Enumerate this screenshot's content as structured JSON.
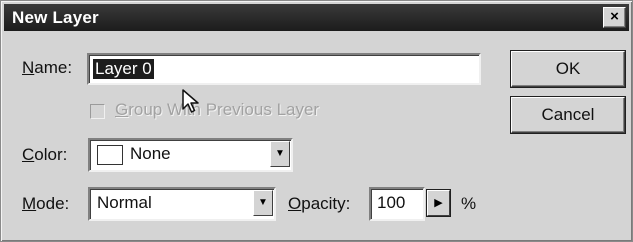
{
  "dialog": {
    "title": "New Layer",
    "close_glyph": "×"
  },
  "name": {
    "label_mnemonic": "N",
    "label_rest": "ame:",
    "value": "Layer 0"
  },
  "group_checkbox": {
    "checked": false,
    "enabled": false,
    "label_mnemonic": "G",
    "label_rest": "roup With Previous Layer"
  },
  "color": {
    "label_mnemonic": "C",
    "label_rest": "olor:",
    "value": "None",
    "swatch_color": "#ffffff"
  },
  "mode": {
    "label_mnemonic": "M",
    "label_rest": "ode:",
    "value": "Normal"
  },
  "opacity": {
    "label_mnemonic": "O",
    "label_rest": "pacity:",
    "value": "100",
    "unit": "%"
  },
  "buttons": {
    "ok": "OK",
    "cancel": "Cancel"
  },
  "icons": {
    "close": "close-icon",
    "dropdown": "chevron-down-icon",
    "slider": "play-arrow-icon",
    "cursor": "mouse-pointer-icon"
  },
  "colors": {
    "titlebar": "#1c1c1c",
    "dialog_bg": "#d4d4d4",
    "selection": "#1c1c1c"
  }
}
